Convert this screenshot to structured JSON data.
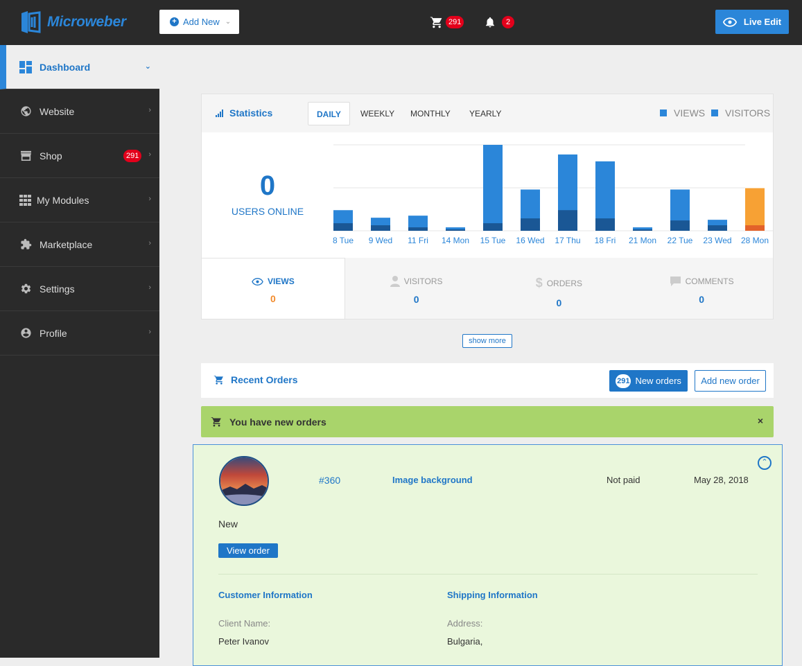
{
  "brand": {
    "name": "Microweber",
    "accent": "#2b86d9"
  },
  "topbar": {
    "add_new": "Add New",
    "cart_count": "291",
    "notif_count": "2",
    "live_edit": "Live Edit"
  },
  "sidebar": {
    "items": [
      {
        "label": "Dashboard",
        "icon": "dashboard-icon"
      },
      {
        "label": "Website",
        "icon": "globe-icon"
      },
      {
        "label": "Shop",
        "icon": "shop-icon",
        "badge": "291"
      },
      {
        "label": "My Modules",
        "icon": "modules-icon"
      },
      {
        "label": "Marketplace",
        "icon": "puzzle-icon"
      },
      {
        "label": "Settings",
        "icon": "gear-icon"
      },
      {
        "label": "Profile",
        "icon": "user-icon"
      }
    ]
  },
  "stats": {
    "title": "Statistics",
    "tabs": [
      "DAILY",
      "WEEKLY",
      "MONTHLY",
      "YEARLY"
    ],
    "legend": [
      "VIEWS",
      "VISITORS"
    ],
    "users_online": "0",
    "users_online_label": "USERS ONLINE",
    "footer": [
      {
        "label": "VIEWS",
        "value": "0",
        "icon": "eye-icon"
      },
      {
        "label": "VISITORS",
        "value": "0",
        "icon": "person-icon"
      },
      {
        "label": "ORDERS",
        "value": "0",
        "icon": "dollar-icon"
      },
      {
        "label": "COMMENTS",
        "value": "0",
        "icon": "comment-icon"
      }
    ]
  },
  "chart_data": {
    "type": "bar",
    "categories": [
      "8 Tue",
      "9 Wed",
      "11 Fri",
      "14 Mon",
      "15 Tue",
      "16 Wed",
      "17 Thu",
      "18 Fri",
      "21 Mon",
      "22 Tue",
      "23 Wed",
      "28 Mon"
    ],
    "series": [
      {
        "name": "VIEWS",
        "values": [
          30,
          19,
          22,
          5,
          125,
          60,
          111,
          101,
          5,
          60,
          16,
          62
        ]
      },
      {
        "name": "VISITORS",
        "values": [
          11,
          8,
          5,
          2,
          11,
          18,
          30,
          18,
          2,
          15,
          8,
          8
        ]
      }
    ],
    "colors": {
      "views": "#2b86d9",
      "visitors": "#1a5795",
      "highlight_views": "#f7a134",
      "highlight_visitors": "#e3622a"
    },
    "ylim": [
      0,
      125
    ],
    "grid": true
  },
  "show_more": "show more",
  "orders": {
    "title": "Recent Orders",
    "new_count": "291",
    "new_label": "New orders",
    "add_label": "Add new order",
    "alert": "You have new orders",
    "alert_close": "×",
    "item": {
      "id": "#360",
      "title": "Image background",
      "payment": "Not paid",
      "date": "May 28, 2018",
      "status": "New",
      "view": "View order",
      "customer_heading": "Customer Information",
      "shipping_heading": "Shipping Information",
      "client_name_label": "Client Name:",
      "client_name": "Peter Ivanov",
      "address_label": "Address:",
      "address": "Bulgaria,"
    }
  }
}
